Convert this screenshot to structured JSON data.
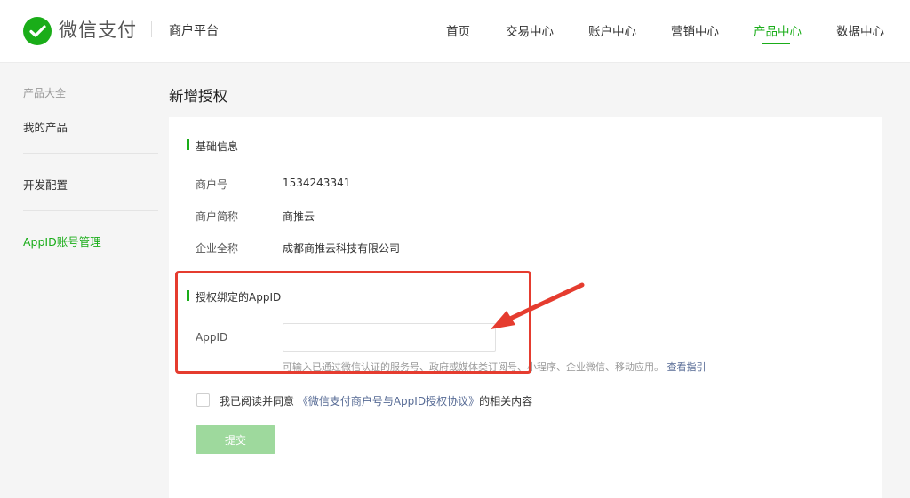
{
  "header": {
    "brand": "微信支付",
    "platform": "商户平台",
    "nav": [
      "首页",
      "交易中心",
      "账户中心",
      "营销中心",
      "产品中心",
      "数据中心"
    ],
    "active_nav": "产品中心"
  },
  "sidebar": {
    "heading": "产品大全",
    "items": [
      {
        "label": "我的产品"
      },
      {
        "label": "开发配置"
      },
      {
        "label": "AppID账号管理"
      }
    ]
  },
  "page": {
    "title": "新增授权"
  },
  "basic_info": {
    "title": "基础信息",
    "rows": [
      {
        "label": "商户号",
        "value": "1534243341"
      },
      {
        "label": "商户简称",
        "value": "商推云"
      },
      {
        "label": "企业全称",
        "value": "成都商推云科技有限公司"
      }
    ]
  },
  "appid_section": {
    "title": "授权绑定的AppID",
    "field_label": "AppID",
    "input_value": "",
    "hint": "可输入已通过微信认证的服务号、政府或媒体类订阅号、小程序、企业微信、移动应用。",
    "hint_link": "查看指引"
  },
  "agreement": {
    "prefix": "我已阅读并同意",
    "link": "《微信支付商户号与AppID授权协议》",
    "suffix": "的相关内容",
    "checked": false
  },
  "submit": {
    "label": "提交"
  },
  "colors": {
    "accent": "#1aad19",
    "link": "#576b95",
    "annotation_red": "#e53c2f",
    "submit_disabled": "#9ed99d"
  },
  "icons": [
    "wechat-pay-logo-icon",
    "annotation-arrow-icon"
  ]
}
